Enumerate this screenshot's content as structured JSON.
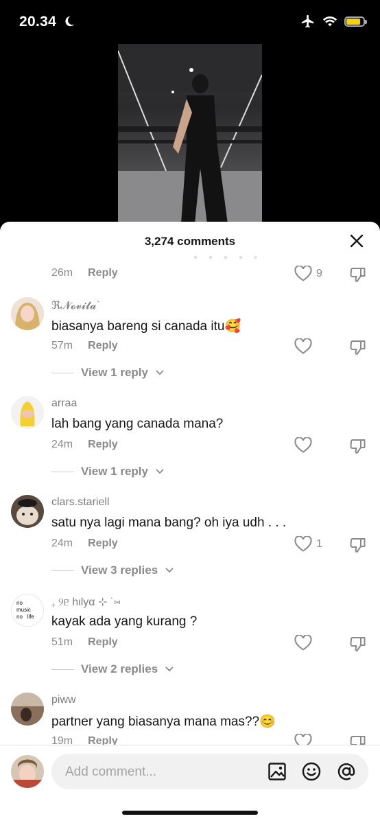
{
  "status": {
    "time": "20.34"
  },
  "video": {},
  "sheet": {
    "title": "3,274 comments"
  },
  "comments": [
    {
      "time": "26m",
      "reply_label": "Reply",
      "likes": "9"
    },
    {
      "username": "ℜ𝓝𝓸𝓿𝓲𝓽𝓪`",
      "text": "biasanya bareng si canada itu🥰",
      "time": "57m",
      "reply_label": "Reply",
      "likes": "",
      "view_replies": "View 1 reply"
    },
    {
      "username": "arraa",
      "text": "lah bang yang canada mana?",
      "time": "24m",
      "reply_label": "Reply",
      "likes": "",
      "view_replies": "View 1 reply"
    },
    {
      "username": "clars.stariell",
      "text": "satu nya lagi mana bang? oh iya udh . . .",
      "time": "24m",
      "reply_label": "Reply",
      "likes": "1",
      "view_replies": "View 3 replies"
    },
    {
      "username": "₊ ୨ᥱ hιlyα ⊹ ˙⑅",
      "text": "kayak ada yang kurang ?",
      "time": "51m",
      "reply_label": "Reply",
      "likes": "",
      "view_replies": "View 2 replies",
      "avatar_text": [
        "no",
        "music",
        "no",
        "life"
      ]
    },
    {
      "username": "piww",
      "text": "partner yang biasanya mana mas??😊",
      "time": "19m",
      "reply_label": "Reply",
      "likes": ""
    }
  ],
  "input": {
    "placeholder": "Add comment..."
  },
  "colors": {
    "battery": "#f5d20a",
    "text": "#161616",
    "muted": "#8a8a8a"
  }
}
